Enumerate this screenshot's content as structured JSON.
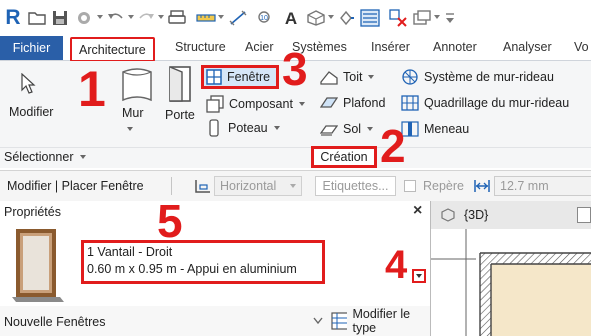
{
  "quick_access": {
    "app_logo": "R",
    "icons": [
      "revit-logo-icon",
      "open-icon",
      "save-icon",
      "sync-icon",
      "undo-icon",
      "redo-icon",
      "print-icon",
      "measure-icon",
      "dimension-icon",
      "tag-icon",
      "text-icon",
      "3d-view-icon",
      "section-icon",
      "thin-lines-icon",
      "close-hidden-icon",
      "switch-windows-icon",
      "customize-icon"
    ]
  },
  "tabs": [
    "Fichier",
    "Architecture",
    "Structure",
    "Acier",
    "Systèmes",
    "Insérer",
    "Annoter",
    "Analyser",
    "Vo"
  ],
  "ribbon": {
    "modifier": "Modifier",
    "mur": "Mur",
    "porte": "Porte",
    "fenetre": "Fenêtre",
    "composant": "Composant",
    "poteau": "Poteau",
    "toit": "Toit",
    "plafond": "Plafond",
    "sol": "Sol",
    "systeme_mur_rideau": "Système de mur-rideau",
    "quadrillage_mur_rideau": "Quadrillage du mur-rideau",
    "meneau": "Meneau",
    "panel_selectionner": "Sélectionner",
    "panel_creation": "Création"
  },
  "option_bar": {
    "context_title": "Modifier | Placer Fenêtre",
    "orientation": "Horizontal",
    "etiquettes": "Etiquettes...",
    "repere": "Repère",
    "distance": "12.7 mm"
  },
  "properties": {
    "title": "Propriétés",
    "close": "×",
    "type_line1": "1 Vantail - Droit",
    "type_line2": "0.60 m x 0.95 m - Appui en aluminium",
    "instance_filter": "Nouvelle Fenêtres",
    "edit_type": "Modifier le type"
  },
  "view": {
    "tab_label": "{3D}"
  },
  "callouts": [
    "1",
    "2",
    "3",
    "4",
    "5"
  ],
  "colors": {
    "accent": "#2a5fa8",
    "highlight": "#e11c1c",
    "tab_blue": "#2a5fa8"
  }
}
